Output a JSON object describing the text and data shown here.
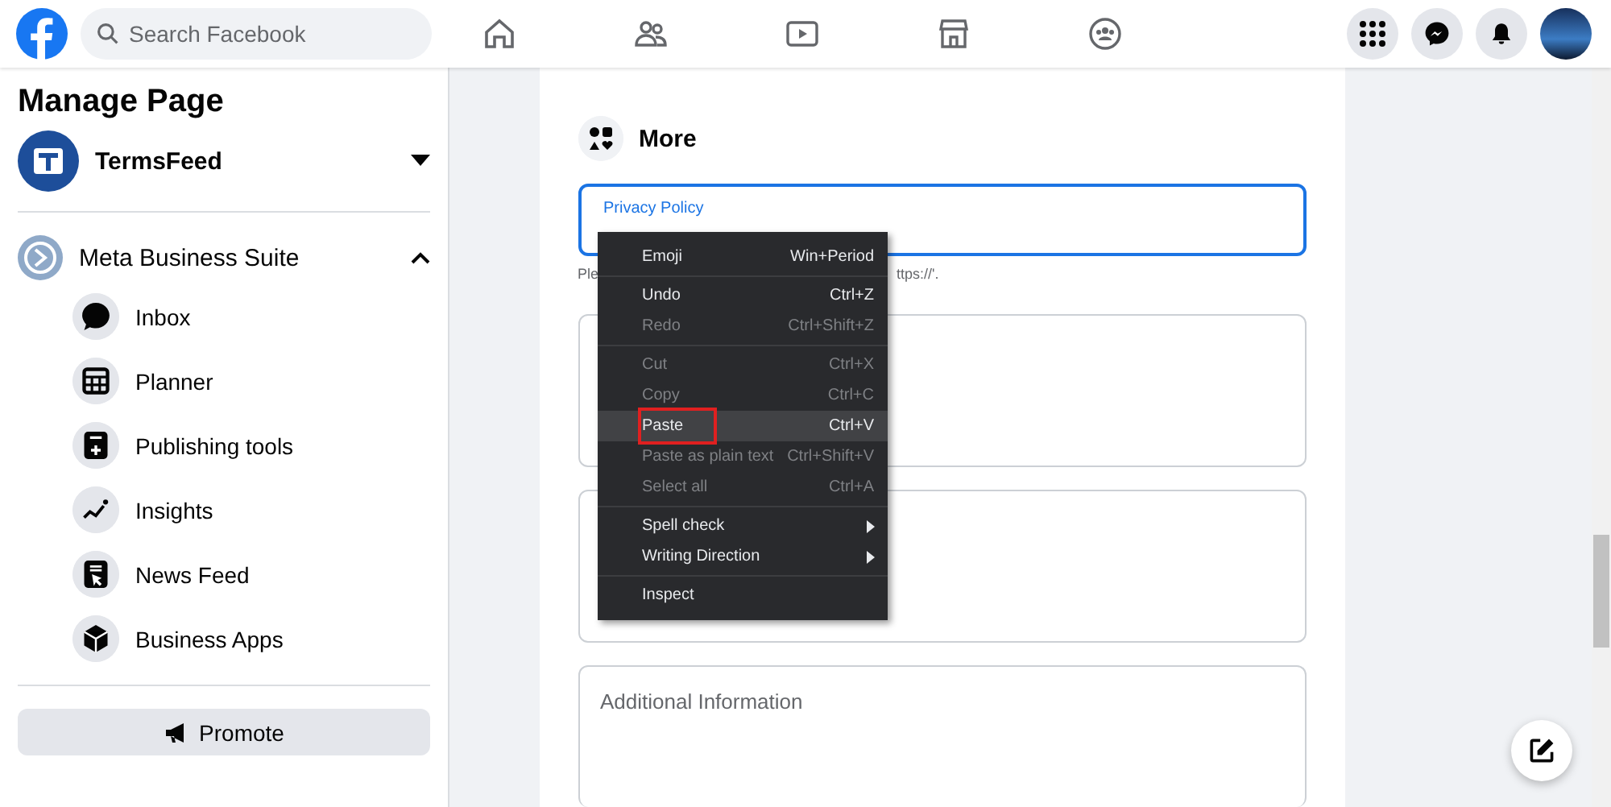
{
  "top_bar": {
    "search": {
      "placeholder": "Search Facebook"
    }
  },
  "sidebar": {
    "title": "Manage Page",
    "page_name": "TermsFeed",
    "section": {
      "title": "Meta Business Suite",
      "expanded": true,
      "items": [
        {
          "label": "Inbox"
        },
        {
          "label": "Planner"
        },
        {
          "label": "Publishing tools"
        },
        {
          "label": "Insights"
        },
        {
          "label": "News Feed"
        },
        {
          "label": "Business Apps"
        }
      ]
    },
    "promote_button": "Promote"
  },
  "main": {
    "section_title": "More",
    "privacy_field": {
      "label": "Privacy Policy",
      "focused": true
    },
    "helper_fragments": [
      "Ple",
      "ttps://'."
    ],
    "additional_field": {
      "placeholder": "Additional Information"
    }
  },
  "context_menu": {
    "groups": [
      [
        {
          "label": "Emoji",
          "shortcut": "Win+Period",
          "disabled": false,
          "selected": false,
          "submenu": false
        }
      ],
      [
        {
          "label": "Undo",
          "shortcut": "Ctrl+Z",
          "disabled": false,
          "selected": false,
          "submenu": false
        },
        {
          "label": "Redo",
          "shortcut": "Ctrl+Shift+Z",
          "disabled": true,
          "selected": false,
          "submenu": false
        }
      ],
      [
        {
          "label": "Cut",
          "shortcut": "Ctrl+X",
          "disabled": true,
          "selected": false,
          "submenu": false
        },
        {
          "label": "Copy",
          "shortcut": "Ctrl+C",
          "disabled": true,
          "selected": false,
          "submenu": false
        },
        {
          "label": "Paste",
          "shortcut": "Ctrl+V",
          "disabled": false,
          "selected": true,
          "submenu": false
        },
        {
          "label": "Paste as plain text",
          "shortcut": "Ctrl+Shift+V",
          "disabled": true,
          "selected": false,
          "submenu": false
        },
        {
          "label": "Select all",
          "shortcut": "Ctrl+A",
          "disabled": true,
          "selected": false,
          "submenu": false
        }
      ],
      [
        {
          "label": "Spell check",
          "disabled": false,
          "selected": false,
          "submenu": true
        },
        {
          "label": "Writing Direction",
          "disabled": false,
          "selected": false,
          "submenu": true
        }
      ],
      [
        {
          "label": "Inspect",
          "disabled": false,
          "selected": false,
          "submenu": false
        }
      ]
    ]
  }
}
